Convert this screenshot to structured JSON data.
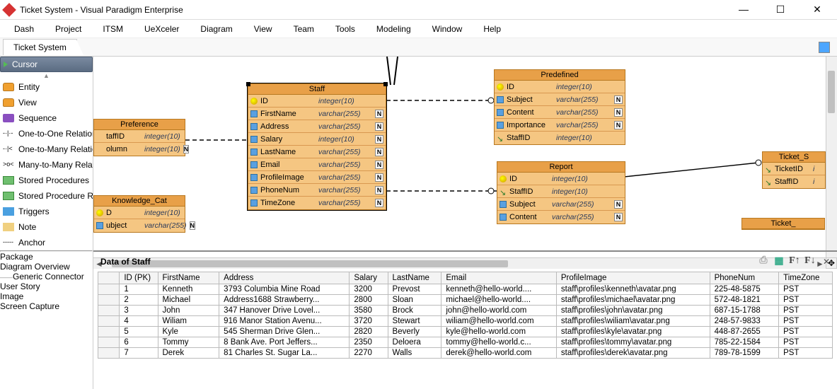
{
  "window": {
    "title": "Ticket System - Visual Paradigm Enterprise"
  },
  "menu": [
    "Dash",
    "Project",
    "ITSM",
    "UeXceler",
    "Diagram",
    "View",
    "Team",
    "Tools",
    "Modeling",
    "Window",
    "Help"
  ],
  "tab": "Ticket System",
  "tools_top": [
    {
      "label": "Cursor",
      "icon": "cursor",
      "sel": true
    },
    {
      "label": "Entity",
      "icon": "db"
    },
    {
      "label": "View",
      "icon": "db"
    },
    {
      "label": "Sequence",
      "icon": "purple"
    },
    {
      "label": "One-to-One Relationship",
      "icon": "rel",
      "glyph": "-·|·-"
    },
    {
      "label": "One-to-Many Relationship",
      "icon": "rel",
      "glyph": "-·|<"
    },
    {
      "label": "Many-to-Many Relationship",
      "icon": "rel",
      "glyph": ">o<"
    },
    {
      "label": "Stored Procedures",
      "icon": "grid"
    },
    {
      "label": "Stored Procedure Resultset",
      "icon": "grid"
    },
    {
      "label": "Triggers",
      "icon": "trig"
    },
    {
      "label": "Note",
      "icon": "note"
    },
    {
      "label": "Anchor",
      "icon": "rel",
      "glyph": "-----"
    }
  ],
  "tools_bottom": [
    {
      "label": "Package",
      "icon": "pkg"
    },
    {
      "label": "Diagram Overview",
      "icon": "pkg"
    },
    {
      "label": "Generic Connector",
      "icon": "rel",
      "glyph": "——"
    },
    {
      "label": "User Story",
      "icon": "pkg"
    },
    {
      "label": "Image",
      "icon": "img"
    },
    {
      "label": "Screen Capture",
      "icon": "cam"
    }
  ],
  "entities": {
    "preference": {
      "name": "Preference",
      "rows": [
        {
          "k": "",
          "f": "taffID",
          "t": "integer(10)",
          "n": false
        },
        {
          "k": "",
          "f": "olumn",
          "t": "integer(10)",
          "n": true
        }
      ]
    },
    "knowledge": {
      "name": "Knowledge_Cat",
      "rows": [
        {
          "k": "pk",
          "f": "D",
          "t": "integer(10)",
          "n": false
        },
        {
          "k": "col",
          "f": "ubject",
          "t": "varchar(255)",
          "n": true
        }
      ]
    },
    "staff": {
      "name": "Staff",
      "rows": [
        {
          "k": "pk",
          "f": "ID",
          "t": "integer(10)",
          "n": false
        },
        {
          "k": "col",
          "f": "FirstName",
          "t": "varchar(255)",
          "n": true
        },
        {
          "k": "col",
          "f": "Address",
          "t": "varchar(255)",
          "n": true
        },
        {
          "k": "col",
          "f": "Salary",
          "t": "integer(10)",
          "n": true
        },
        {
          "k": "col",
          "f": "LastName",
          "t": "varchar(255)",
          "n": true
        },
        {
          "k": "col",
          "f": "Email",
          "t": "varchar(255)",
          "n": true
        },
        {
          "k": "col",
          "f": "ProfileImage",
          "t": "varchar(255)",
          "n": true
        },
        {
          "k": "col",
          "f": "PhoneNum",
          "t": "varchar(255)",
          "n": true
        },
        {
          "k": "col",
          "f": "TimeZone",
          "t": "varchar(255)",
          "n": true
        }
      ]
    },
    "predefined": {
      "name": "Predefined",
      "rows": [
        {
          "k": "pk",
          "f": "ID",
          "t": "integer(10)",
          "n": false
        },
        {
          "k": "col",
          "f": "Subject",
          "t": "varchar(255)",
          "n": true
        },
        {
          "k": "col",
          "f": "Content",
          "t": "varchar(255)",
          "n": true
        },
        {
          "k": "col",
          "f": "Importance",
          "t": "varchar(255)",
          "n": true
        },
        {
          "k": "fk",
          "f": "StaffID",
          "t": "integer(10)",
          "n": false
        }
      ]
    },
    "report": {
      "name": "Report",
      "rows": [
        {
          "k": "pk",
          "f": "ID",
          "t": "integer(10)",
          "n": false
        },
        {
          "k": "fk",
          "f": "StaffID",
          "t": "integer(10)",
          "n": false
        },
        {
          "k": "col",
          "f": "Subject",
          "t": "varchar(255)",
          "n": true
        },
        {
          "k": "col",
          "f": "Content",
          "t": "varchar(255)",
          "n": true
        }
      ]
    },
    "ticket_s": {
      "name": "Ticket_S",
      "rows": [
        {
          "k": "fk",
          "f": "TicketID",
          "t": "i",
          "n": false
        },
        {
          "k": "fk",
          "f": "StaffID",
          "t": "i",
          "n": false
        }
      ]
    },
    "ticket": {
      "name": "Ticket_"
    }
  },
  "datapane": {
    "title": "Data of Staff",
    "columns": [
      "ID (PK)",
      "FirstName",
      "Address",
      "Salary",
      "LastName",
      "Email",
      "ProfileImage",
      "PhoneNum",
      "TimeZone"
    ],
    "rows": [
      [
        "1",
        "Kenneth",
        "3793 Columbia Mine Road",
        "3200",
        "Prevost",
        "kenneth@hello-world....",
        "staff\\profiles\\kenneth\\avatar.png",
        "225-48-5875",
        "PST"
      ],
      [
        "2",
        "Michael",
        "Address1688 Strawberry...",
        "2800",
        "Sloan",
        "michael@hello-world....",
        "staff\\profiles\\michael\\avatar.png",
        "572-48-1821",
        "PST"
      ],
      [
        "3",
        "John",
        "347 Hanover Drive  Lovel...",
        "3580",
        "Brock",
        "john@hello-world.com",
        "staff\\profiles\\john\\avatar.png",
        "687-15-1788",
        "PST"
      ],
      [
        "4",
        "Wiliam",
        "916 Manor Station Avenu...",
        "3720",
        "Stewart",
        "wiliam@hello-world.com",
        "staff\\profiles\\wiliam\\avatar.png",
        "248-57-9833",
        "PST"
      ],
      [
        "5",
        "Kyle",
        "545 Sherman Drive  Glen...",
        "2820",
        "Beverly",
        "kyle@hello-world.com",
        "staff\\profiles\\kyle\\avatar.png",
        "448-87-2655",
        "PST"
      ],
      [
        "6",
        "Tommy",
        "8 Bank Ave.  Port Jeffers...",
        "2350",
        "Deloera",
        "tommy@hello-world.c...",
        "staff\\profiles\\tommy\\avatar.png",
        "785-22-1584",
        "PST"
      ],
      [
        "7",
        "Derek",
        "81 Charles St.  Sugar La...",
        "2270",
        "Walls",
        "derek@hello-world.com",
        "staff\\profiles\\derek\\avatar.png",
        "789-78-1599",
        "PST"
      ]
    ]
  }
}
